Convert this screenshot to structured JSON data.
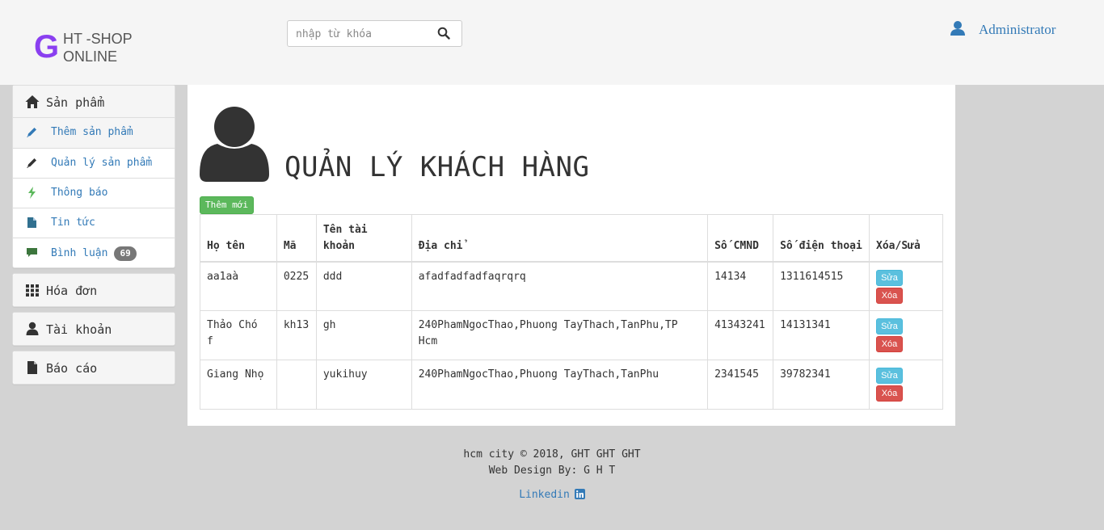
{
  "header": {
    "logo_letter": "G",
    "logo_line1": "HT -SHOP",
    "logo_line2": "ONLINE",
    "search_placeholder": "nhập từ khóa",
    "user_name": "Administrator"
  },
  "sidebar": {
    "products_label": "Sản phẩm",
    "items": [
      {
        "label": "Thêm sản phẩm",
        "icon": "pencil-icon"
      },
      {
        "label": "Quản lý sản phẩm",
        "icon": "pencil-icon"
      },
      {
        "label": "Thông báo",
        "icon": "flash-icon"
      },
      {
        "label": "Tin tức",
        "icon": "file-icon"
      },
      {
        "label": "Bình luận",
        "icon": "comment-icon",
        "badge": "69"
      }
    ],
    "invoices_label": "Hóa đơn",
    "accounts_label": "Tài khoản",
    "reports_label": "Báo cáo"
  },
  "main": {
    "title": "QUẢN LÝ KHÁCH HÀNG",
    "add_label": "Thêm mới",
    "columns": [
      "Họ tên",
      "Mã",
      "Tên tài khoản",
      "Địa chỉ",
      "Số CMND",
      "Số điện thoại",
      "Xóa/Sửa"
    ],
    "edit_label": "Sửa",
    "delete_label": "Xóa",
    "rows": [
      {
        "name": "aa1aà",
        "code": "0225",
        "username": "ddd",
        "address": "afadfadfadfaqrqrq",
        "id_number": "14134",
        "phone": "1311614515"
      },
      {
        "name": "Thảo Chó f",
        "code": "kh13",
        "username": "gh",
        "address": "240PhamNgocThao,Phuong TayThach,TanPhu,TP Hcm",
        "id_number": "41343241",
        "phone": "14131341"
      },
      {
        "name": "Giang Nhọ",
        "code": "",
        "username": "yukihuy",
        "address": "240PhamNgocThao,Phuong TayThach,TanPhu",
        "id_number": "2341545",
        "phone": "39782341"
      }
    ]
  },
  "footer": {
    "line1": "hcm city © 2018, GHT GHT GHT",
    "line2": "Web Design By: G H T",
    "link": "Linkedin"
  },
  "colors": {
    "accent": "#337ab7",
    "logo": "#8a3ff0",
    "success": "#5cb85c",
    "info": "#5bc0de",
    "danger": "#d9534f"
  }
}
